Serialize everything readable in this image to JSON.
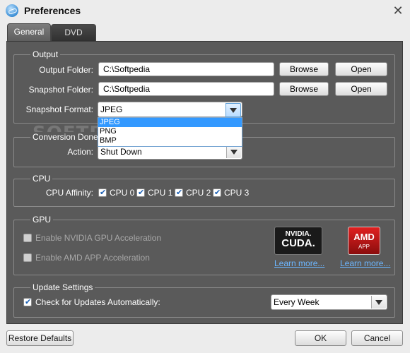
{
  "window": {
    "title": "Preferences",
    "close_glyph": "✕"
  },
  "tabs": [
    {
      "label": "General"
    },
    {
      "label": "DVD"
    }
  ],
  "output": {
    "legend": "Output",
    "output_folder_label": "Output Folder:",
    "output_folder_value": "C:\\Softpedia",
    "snapshot_folder_label": "Snapshot Folder:",
    "snapshot_folder_value": "C:\\Softpedia",
    "browse_label": "Browse",
    "open_label": "Open",
    "snapshot_format_label": "Snapshot Format:",
    "snapshot_format_value": "JPEG",
    "format_options": [
      "JPEG",
      "PNG",
      "BMP"
    ]
  },
  "watermark": "SOFTPEDIA",
  "conversion": {
    "legend": "Conversion Done",
    "action_label": "Action:",
    "action_value": "Shut Down"
  },
  "cpu": {
    "legend": "CPU",
    "affinity_label": "CPU Affinity:",
    "cores": [
      "CPU 0",
      "CPU 1",
      "CPU 2",
      "CPU 3"
    ]
  },
  "gpu": {
    "legend": "GPU",
    "nvidia_label": "Enable NVIDIA GPU Acceleration",
    "amd_label": "Enable AMD APP Acceleration",
    "nvidia_logo_top": "NVIDIA.",
    "nvidia_logo_bottom": "CUDA.",
    "amd_logo_top": "AMD",
    "amd_logo_bottom": "APP",
    "learn_more": "Learn more..."
  },
  "update": {
    "legend": "Update Settings",
    "check_label": "Check for Updates Automatically:",
    "frequency_value": "Every Week"
  },
  "footer": {
    "restore_label": "Restore Defaults",
    "ok_label": "OK",
    "cancel_label": "Cancel"
  },
  "colors": {
    "panel": "#5a5a5a",
    "link": "#6cb6ff",
    "selection": "#3399ff",
    "amd_red": "#c41818"
  }
}
